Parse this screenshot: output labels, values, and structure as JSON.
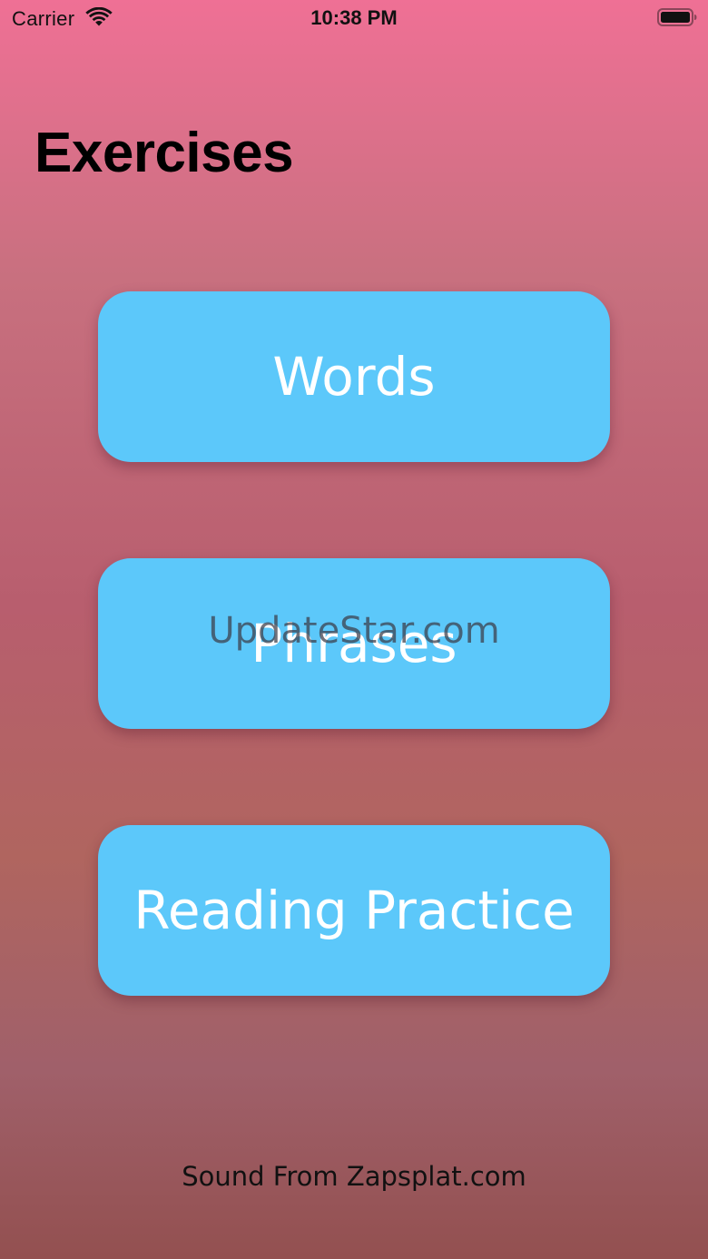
{
  "status_bar": {
    "carrier": "Carrier",
    "time": "10:38 PM",
    "wifi_icon": "wifi-icon",
    "battery_icon": "battery-icon"
  },
  "page": {
    "title": "Exercises"
  },
  "buttons": {
    "words": "Words",
    "phrases": "Phrases",
    "reading": "Reading Practice"
  },
  "watermark": "UpdateStar.com",
  "footer": {
    "credit": "Sound From Zapsplat.com"
  },
  "colors": {
    "button": "#5cc8fa",
    "gradient_top": "#ef7095",
    "gradient_bottom": "#935050"
  }
}
